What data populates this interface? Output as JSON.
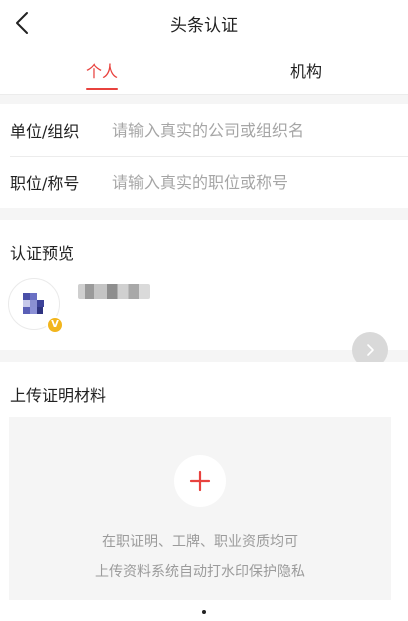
{
  "nav": {
    "title": "头条认证"
  },
  "tabs": [
    {
      "label": "个人",
      "active": true
    },
    {
      "label": "机构",
      "active": false
    }
  ],
  "form": {
    "org_label": "单位/组织",
    "org_placeholder": "请输入真实的公司或组织名",
    "org_value": "",
    "title_label": "职位/称号",
    "title_placeholder": "请输入真实的职位或称号",
    "title_value": ""
  },
  "preview": {
    "section_title": "认证预览",
    "badge_letter": "V"
  },
  "upload": {
    "section_title": "上传证明材料",
    "hint_line1": "在职证明、工牌、职业资质均可",
    "hint_line2": "上传资料系统自动打水印保护隐私"
  },
  "colors": {
    "accent": "#e8423e",
    "badge": "#f2b51d",
    "placeholder": "#a6a6a6",
    "hint": "#9b9b9b"
  },
  "icons": {
    "back": "chevron-left-icon",
    "next": "chevron-right-icon",
    "add": "plus-icon",
    "verified": "verified-v-icon"
  }
}
